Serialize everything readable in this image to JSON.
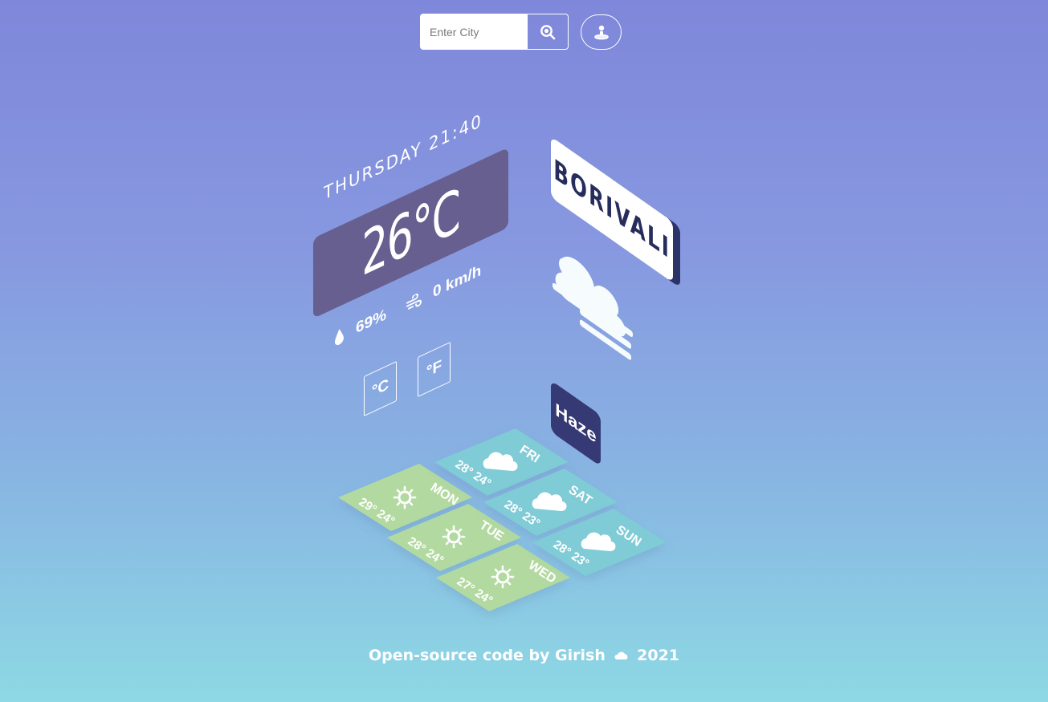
{
  "search": {
    "placeholder": "Enter City"
  },
  "icons": {
    "search_button": "search-icon",
    "locate_button": "location-pin-icon",
    "humidity": "water-drop-icon",
    "wind": "wind-icon",
    "current_weather": "cloud-haze-icon"
  },
  "current": {
    "day_time": "THURSDAY 21:40",
    "temperature": "26°C",
    "humidity": "69%",
    "wind": "0 km/h",
    "city": "BORIVALI",
    "condition": "Haze"
  },
  "units": {
    "celsius_label": "°C",
    "fahrenheit_label": "°F"
  },
  "forecast": [
    {
      "day": "MON",
      "temps": "29° 24°",
      "icon": "sun-icon"
    },
    {
      "day": "TUE",
      "temps": "28° 24°",
      "icon": "sun-icon"
    },
    {
      "day": "WED",
      "temps": "27° 24°",
      "icon": "sun-icon"
    },
    {
      "day": "FRI",
      "temps": "28° 24°",
      "icon": "cloud-icon"
    },
    {
      "day": "SAT",
      "temps": "28° 23°",
      "icon": "cloud-icon"
    },
    {
      "day": "SUN",
      "temps": "28° 23°",
      "icon": "cloud-icon"
    }
  ],
  "footer": {
    "prefix": "Open-source code by Girish",
    "year": "2021"
  },
  "colors": {
    "temp_card": "#665f8f",
    "city_card_edge": "#2b3468",
    "haze_card": "#353974",
    "sunny_tile": "#b2d9a0",
    "cloudy_tile": "#7fcbd6"
  }
}
